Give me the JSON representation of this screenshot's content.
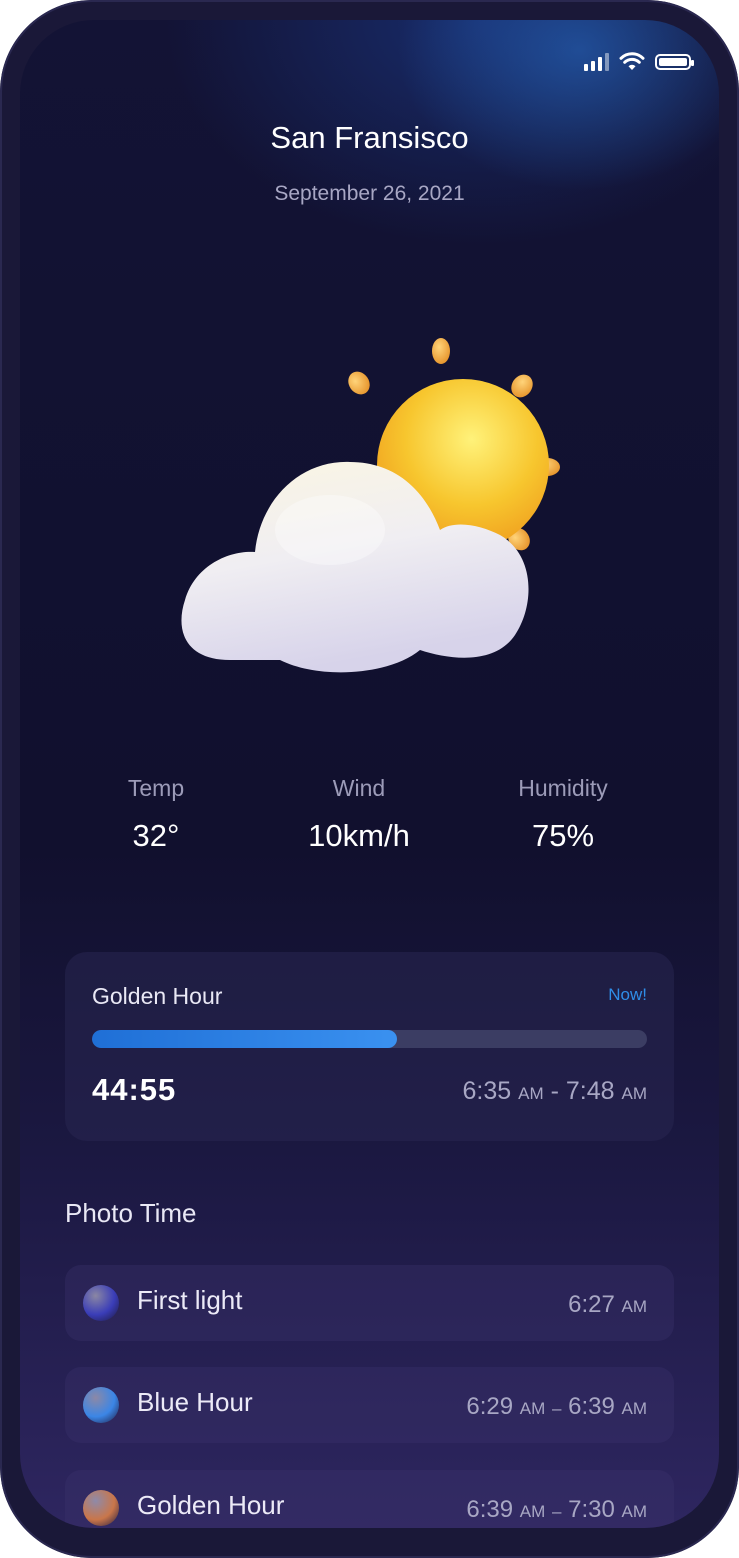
{
  "status_bar": {
    "signal_icon": "signal-icon",
    "wifi_icon": "wifi-icon",
    "battery_icon": "battery-icon"
  },
  "header": {
    "city": "San Fransisco",
    "date": "September 26, 2021"
  },
  "weather_icon": "partly-cloudy-icon",
  "stats": [
    {
      "label": "Temp",
      "value": "32°"
    },
    {
      "label": "Wind",
      "value": "10km/h"
    },
    {
      "label": "Humidity",
      "value": "75%"
    }
  ],
  "golden_hour": {
    "title": "Golden Hour",
    "badge": "Now!",
    "progress_fraction": 0.55,
    "countdown": "44:55",
    "start": "6:35",
    "start_suffix": "AM",
    "separator": "-",
    "end": "7:48",
    "end_suffix": "AM"
  },
  "photo_time": {
    "title": "Photo Time",
    "items": [
      {
        "label": "First light",
        "time_start": "6:27",
        "start_suffix": "AM",
        "separator": "",
        "time_end": "",
        "end_suffix": "",
        "dot_color": "#3a3db8"
      },
      {
        "label": "Blue Hour",
        "time_start": "6:29",
        "start_suffix": "AM",
        "separator": "–",
        "time_end": "6:39",
        "end_suffix": "AM",
        "dot_color": "#3b86e6"
      },
      {
        "label": "Golden Hour",
        "time_start": "6:39",
        "start_suffix": "AM",
        "separator": "–",
        "time_end": "7:30",
        "end_suffix": "AM",
        "dot_color": "#c9764a"
      }
    ]
  },
  "colors": {
    "accent": "#2f8ee8",
    "background": "#111130"
  }
}
